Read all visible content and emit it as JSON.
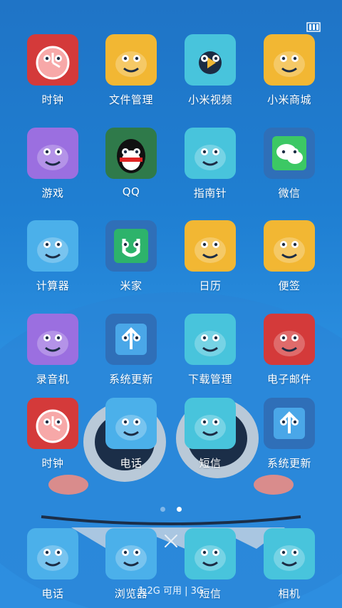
{
  "screen": {
    "rows": [
      [
        {
          "label": "时钟",
          "icon": "clock-monster-icon",
          "color": "#d43a3a"
        },
        {
          "label": "文件管理",
          "icon": "folder-monster-icon",
          "color": "#f2b733"
        },
        {
          "label": "小米视频",
          "icon": "video-monster-icon",
          "color": "#48c4dc"
        },
        {
          "label": "小米商城",
          "icon": "shop-monster-icon",
          "color": "#f2b733"
        }
      ],
      [
        {
          "label": "游戏",
          "icon": "gamepad-monster-icon",
          "color": "#9b6fe0"
        },
        {
          "label": "QQ",
          "icon": "qq-penguin-icon",
          "color": "#2f7a4a"
        },
        {
          "label": "指南针",
          "icon": "compass-monster-icon",
          "color": "#48c4dc"
        },
        {
          "label": "微信",
          "icon": "wechat-icon",
          "color": "#2f6fb8"
        }
      ],
      [
        {
          "label": "计算器",
          "icon": "calculator-monster-icon",
          "color": "#4bb0ea"
        },
        {
          "label": "米家",
          "icon": "mijia-icon",
          "color": "#2f6fb8"
        },
        {
          "label": "日历",
          "icon": "calendar-monster-icon",
          "color": "#f2b733"
        },
        {
          "label": "便签",
          "icon": "notes-monster-icon",
          "color": "#f2b733"
        }
      ],
      [
        {
          "label": "录音机",
          "icon": "recorder-monster-icon",
          "color": "#9b6fe0"
        },
        {
          "label": "系统更新",
          "icon": "update-arrow-icon",
          "color": "#2f6fb8"
        },
        {
          "label": "下载管理",
          "icon": "download-monster-icon",
          "color": "#48c4dc"
        },
        {
          "label": "电子邮件",
          "icon": "email-monster-icon",
          "color": "#d43a3a"
        }
      ],
      [
        {
          "label": "时钟",
          "icon": "clock-monster-icon",
          "color": "#d43a3a"
        },
        {
          "label": "电话",
          "icon": "phone-monster-icon",
          "color": "#4bb0ea"
        },
        {
          "label": "短信",
          "icon": "sms-monster-icon",
          "color": "#48c4dc"
        },
        {
          "label": "系统更新",
          "icon": "update-arrow-icon",
          "color": "#2f6fb8"
        }
      ]
    ],
    "dock": [
      {
        "label": "电话",
        "icon": "phone-monster-icon",
        "color": "#4bb0ea"
      },
      {
        "label": "浏览器",
        "icon": "browser-monster-icon",
        "color": "#4bb0ea"
      },
      {
        "label": "短信",
        "icon": "sms-monster-icon",
        "color": "#48c4dc"
      },
      {
        "label": "相机",
        "icon": "camera-monster-icon",
        "color": "#48c4dc"
      }
    ]
  },
  "page_indicator": {
    "count": 2,
    "active": 2
  },
  "memory": {
    "text": "1.2G 可用 | 3G"
  },
  "colors": {
    "background": "#1f7fd2",
    "label": "#ffffff"
  }
}
